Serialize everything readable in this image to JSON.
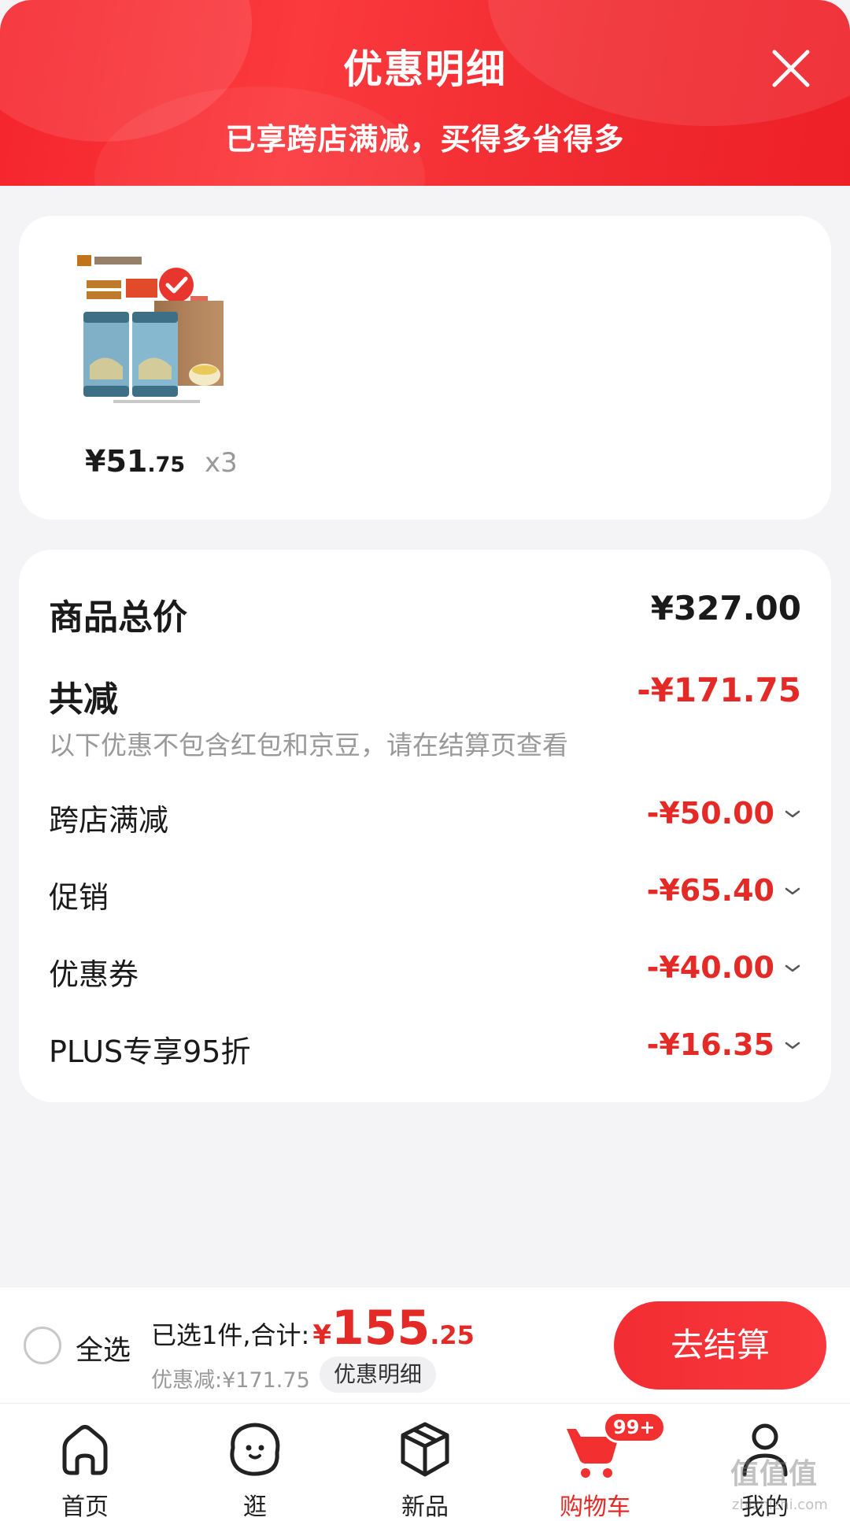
{
  "header": {
    "title": "优惠明细",
    "subtitle": "已享跨店满减，买得多省得多"
  },
  "product": {
    "price_int": "¥51",
    "price_dec": ".75",
    "quantity": "x3",
    "image_icon": "tea-product-image"
  },
  "summary": {
    "total_label": "商品总价",
    "total_value": "¥327.00",
    "reduce_label": "共减",
    "reduce_value": "-¥171.75",
    "note": "以下优惠不包含红包和京豆，请在结算页查看",
    "discounts": [
      {
        "label": "跨店满减",
        "value": "-¥50.00"
      },
      {
        "label": "促销",
        "value": "-¥65.40"
      },
      {
        "label": "优惠券",
        "value": "-¥40.00"
      },
      {
        "label": "PLUS专享95折",
        "value": "-¥16.35"
      }
    ]
  },
  "checkout": {
    "select_all": "全选",
    "selected_text": "已选1件,合计:",
    "currency": "¥",
    "total_int": "155",
    "total_dec": ".25",
    "discount_line": "优惠减:¥171.75",
    "detail_button": "优惠明细",
    "checkout_button": "去结算"
  },
  "nav": {
    "items": [
      {
        "label": "首页",
        "icon": "home-icon"
      },
      {
        "label": "逛",
        "icon": "browse-icon"
      },
      {
        "label": "新品",
        "icon": "box-icon"
      },
      {
        "label": "购物车",
        "icon": "cart-icon",
        "badge": "99+",
        "active": true
      },
      {
        "label": "我的",
        "icon": "user-icon"
      }
    ]
  },
  "watermark": {
    "text": "值值值",
    "sub": "zhizhizhi.com"
  },
  "colors": {
    "accent": "#f23030",
    "price_red": "#e42a26"
  }
}
